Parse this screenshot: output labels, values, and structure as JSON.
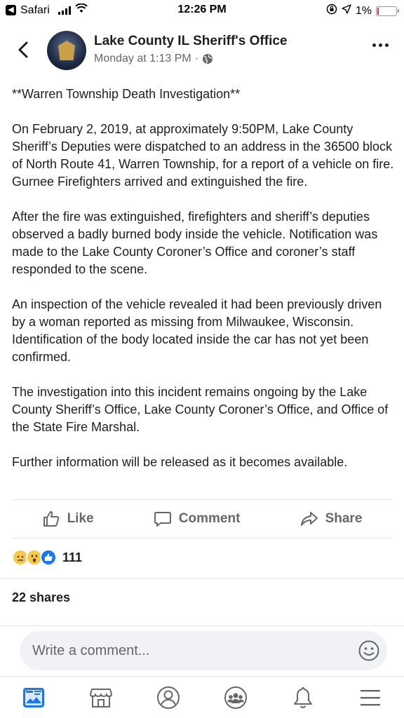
{
  "status_bar": {
    "back_app": "Safari",
    "time": "12:26 PM",
    "battery": "1%",
    "icons": [
      "signal-icon",
      "wifi-icon",
      "orientation-lock-icon",
      "location-icon",
      "battery-icon"
    ]
  },
  "header": {
    "page_name": "Lake County IL Sheriff's Office",
    "timestamp": "Monday at 1:13 PM",
    "separator": "·",
    "privacy_icon": "globe-icon"
  },
  "post": {
    "paragraphs": [
      "**Warren Township Death Investigation**",
      "On February 2, 2019, at approximately 9:50PM, Lake County Sheriff’s Deputies were dispatched to an address in the 36500 block of North Route 41, Warren Township, for a report of a vehicle on fire.  Gurnee Firefighters arrived and extinguished the fire.",
      "After the fire was extinguished, firefighters and sheriff’s deputies observed a badly burned body inside the vehicle. Notification was made to the Lake County Coroner’s Office and coroner’s staff responded to the scene.",
      "An inspection of the vehicle revealed it had been previously driven by a woman reported as missing from Milwaukee, Wisconsin.  Identification of the body located inside the car has not yet been confirmed.",
      "The investigation into this incident remains ongoing by the Lake County Sheriff’s Office, Lake County Coroner’s Office, and Office of the State Fire Marshal.",
      "Further information will be released as it becomes available."
    ]
  },
  "actions": {
    "like": "Like",
    "comment": "Comment",
    "share": "Share"
  },
  "reactions": {
    "types": [
      "sad",
      "wow",
      "like"
    ],
    "count": "111"
  },
  "shares": "22 shares",
  "comment_box": {
    "placeholder": "Write a comment..."
  },
  "bottom_nav": {
    "items": [
      "news-feed-icon",
      "marketplace-icon",
      "profile-icon",
      "groups-icon",
      "notifications-icon",
      "menu-icon"
    ],
    "active_color": "#1877f2"
  },
  "colors": {
    "brand_blue": "#1877f2",
    "secondary_text": "#65676b",
    "battery_low": "#e0245e"
  }
}
